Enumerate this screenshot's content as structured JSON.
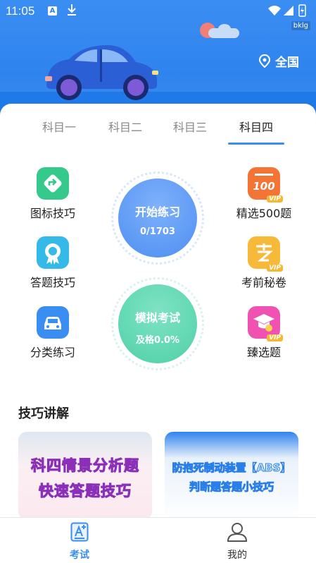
{
  "status_bar": {
    "time": "11:05",
    "badge": "bklg"
  },
  "header": {
    "location_label": "全国"
  },
  "tabs": [
    {
      "label": "科目一"
    },
    {
      "label": "科目二"
    },
    {
      "label": "科目三"
    },
    {
      "label": "科目四",
      "active": true
    }
  ],
  "features_left": [
    {
      "label": "图标技巧",
      "icon": "signpost-icon",
      "color": "#35c98c"
    },
    {
      "label": "答题技巧",
      "icon": "ribbon-icon",
      "color": "#35b9e8"
    },
    {
      "label": "分类练习",
      "icon": "car-icon",
      "color": "#3a8ef2"
    }
  ],
  "features_right": [
    {
      "label": "精选500题",
      "icon": "100-icon",
      "color": "#f47436",
      "vip": "VIP"
    },
    {
      "label": "考前秘卷",
      "icon": "exam-icon",
      "color": "#f7b93a",
      "vip": "VIP"
    },
    {
      "label": "臻选题",
      "icon": "grad-cap-icon",
      "color": "#f052b2",
      "vip": "VIP"
    }
  ],
  "practice": {
    "title": "开始练习",
    "progress": "0/1703"
  },
  "mock_exam": {
    "title": "模拟考试",
    "pass_rate": "及格0.0%"
  },
  "section": {
    "title": "技巧讲解"
  },
  "banners": [
    {
      "line1": "科四情景分析题",
      "line2": "快速答题技巧"
    },
    {
      "line1": "防抱死制动装置【ABS】",
      "line2": "判断题答题小技巧"
    }
  ],
  "bottom_nav": [
    {
      "label": "考试",
      "active": true
    },
    {
      "label": "我的"
    }
  ],
  "colors": {
    "accent": "#3a8ef2",
    "vip": "#f5b830"
  }
}
